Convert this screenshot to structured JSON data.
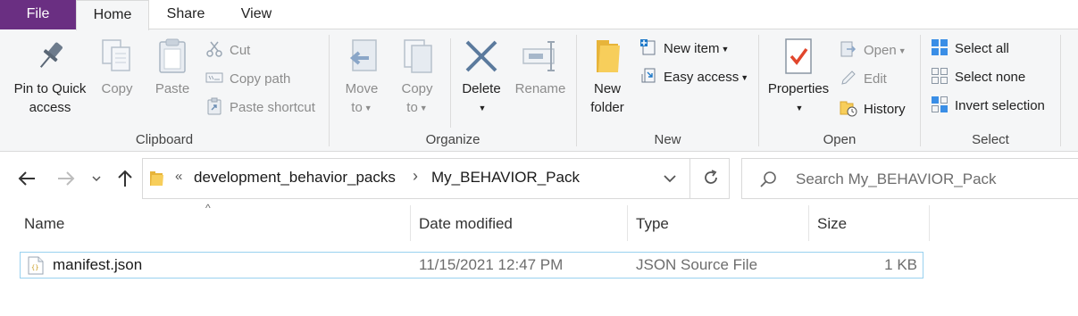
{
  "tabs": {
    "file": "File",
    "home": "Home",
    "share": "Share",
    "view": "View"
  },
  "clipboard": {
    "label": "Clipboard",
    "pin_line1": "Pin to Quick",
    "pin_line2": "access",
    "copy": "Copy",
    "paste": "Paste",
    "cut": "Cut",
    "copy_path": "Copy path",
    "paste_shortcut": "Paste shortcut"
  },
  "organize": {
    "label": "Organize",
    "move_line1": "Move",
    "move_line2": "to",
    "copy_line1": "Copy",
    "copy_line2": "to",
    "delete": "Delete",
    "rename": "Rename"
  },
  "new_group": {
    "label": "New",
    "new_folder_line1": "New",
    "new_folder_line2": "folder",
    "new_item": "New item",
    "easy_access": "Easy access"
  },
  "open_group": {
    "label": "Open",
    "properties": "Properties",
    "open": "Open",
    "edit": "Edit",
    "history": "History"
  },
  "select_group": {
    "label": "Select",
    "select_all": "Select all",
    "select_none": "Select none",
    "invert_selection": "Invert selection"
  },
  "address": {
    "overflow": "«",
    "crumbs": [
      "development_behavior_packs",
      "My_BEHAVIOR_Pack"
    ],
    "separator": "›"
  },
  "search": {
    "placeholder": "Search My_BEHAVIOR_Pack"
  },
  "columns": {
    "name": "Name",
    "date_modified": "Date modified",
    "type": "Type",
    "size": "Size"
  },
  "files": [
    {
      "name": "manifest.json",
      "date_modified": "11/15/2021 12:47 PM",
      "type": "JSON Source File",
      "size": "1 KB"
    }
  ],
  "colors": {
    "file_tab": "#6a2f82",
    "ribbon_bg": "#f5f6f7",
    "selection_border": "#99d1ef",
    "accent_blue": "#1e78c8",
    "folder_yellow": "#f4c542"
  }
}
